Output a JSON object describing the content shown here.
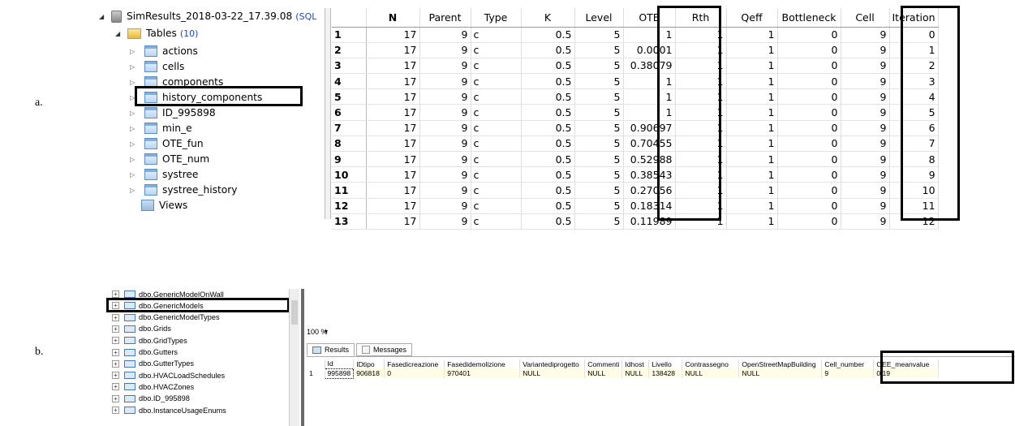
{
  "labels": {
    "a": "a.",
    "b": "b."
  },
  "panel_a": {
    "db_name": "SimResults_2018-03-22_17.39.08",
    "db_suffix": "(SQL",
    "tables_label": "Tables",
    "tables_count": "(10)",
    "tables": [
      "actions",
      "cells",
      "components",
      "history_components",
      "ID_995898",
      "min_e",
      "OTE_fun",
      "OTE_num",
      "systree",
      "systree_history"
    ],
    "views_label": "Views",
    "columns": [
      "N",
      "Parent",
      "Type",
      "K",
      "Level",
      "OTE",
      "Rth",
      "Qeff",
      "Bottleneck",
      "Cell",
      "Iteration"
    ],
    "rows": [
      [
        "1",
        "17",
        "9",
        "c",
        "0.5",
        "5",
        "1",
        "1",
        "1",
        "0",
        "9",
        "0"
      ],
      [
        "2",
        "17",
        "9",
        "c",
        "0.5",
        "5",
        "0.0001",
        "1",
        "1",
        "0",
        "9",
        "1"
      ],
      [
        "3",
        "17",
        "9",
        "c",
        "0.5",
        "5",
        "0.38079",
        "1",
        "1",
        "0",
        "9",
        "2"
      ],
      [
        "4",
        "17",
        "9",
        "c",
        "0.5",
        "5",
        "1",
        "1",
        "1",
        "0",
        "9",
        "3"
      ],
      [
        "5",
        "17",
        "9",
        "c",
        "0.5",
        "5",
        "1",
        "1",
        "1",
        "0",
        "9",
        "4"
      ],
      [
        "6",
        "17",
        "9",
        "c",
        "0.5",
        "5",
        "1",
        "1",
        "1",
        "0",
        "9",
        "5"
      ],
      [
        "7",
        "17",
        "9",
        "c",
        "0.5",
        "5",
        "0.90697",
        "1",
        "1",
        "0",
        "9",
        "6"
      ],
      [
        "8",
        "17",
        "9",
        "c",
        "0.5",
        "5",
        "0.70455",
        "1",
        "1",
        "0",
        "9",
        "7"
      ],
      [
        "9",
        "17",
        "9",
        "c",
        "0.5",
        "5",
        "0.52988",
        "1",
        "1",
        "0",
        "9",
        "8"
      ],
      [
        "10",
        "17",
        "9",
        "c",
        "0.5",
        "5",
        "0.38543",
        "1",
        "1",
        "0",
        "9",
        "9"
      ],
      [
        "11",
        "17",
        "9",
        "c",
        "0.5",
        "5",
        "0.27056",
        "1",
        "1",
        "0",
        "9",
        "10"
      ],
      [
        "12",
        "17",
        "9",
        "c",
        "0.5",
        "5",
        "0.18314",
        "1",
        "1",
        "0",
        "9",
        "11"
      ],
      [
        "13",
        "17",
        "9",
        "c",
        "0.5",
        "5",
        "0.11989",
        "1",
        "1",
        "0",
        "9",
        "12"
      ]
    ]
  },
  "panel_b": {
    "tree": [
      "dbo.GenericModelOnWall",
      "dbo.GenericModels",
      "dbo.GenericModelTypes",
      "dbo.Grids",
      "dbo.GridTypes",
      "dbo.Gutters",
      "dbo.GutterTypes",
      "dbo.HVACLoadSchedules",
      "dbo.HVACZones",
      "dbo.ID_995898",
      "dbo.InstanceUsageEnums"
    ],
    "zoom": "100 %",
    "tabs": {
      "results": "Results",
      "messages": "Messages"
    },
    "columns": [
      "Id",
      "IDtipo",
      "Fasedicreazione",
      "Fasedidemolizione",
      "Variantediprogetto",
      "Commenti",
      "Idhost",
      "Livello",
      "Contrassegno",
      "OpenStreetMapBuilding",
      "Cell_number",
      "OEE_meanvalue"
    ],
    "row": [
      "1",
      "995898",
      "906818",
      "0",
      "970401",
      "NULL",
      "NULL",
      "NULL",
      "138428",
      "NULL",
      "NULL",
      "9",
      "0.19"
    ]
  }
}
